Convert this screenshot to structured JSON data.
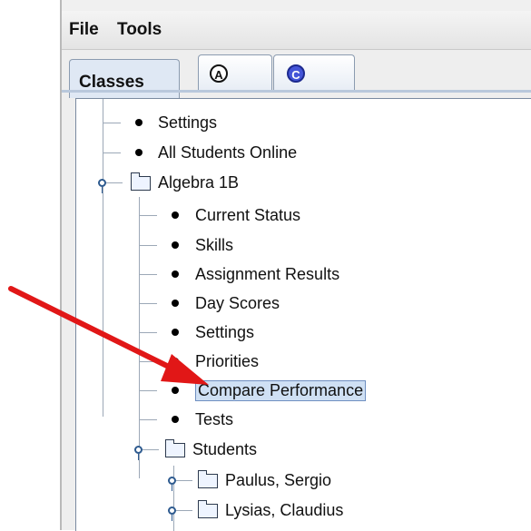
{
  "menu": [
    "File",
    "Tools"
  ],
  "tabs": {
    "classes_label": "Classes",
    "a_glyph": "A",
    "c_glyph": "C"
  },
  "tree": [
    {
      "label": "Settings",
      "level": 0,
      "kind": "bullet"
    },
    {
      "label": "All Students Online",
      "level": 0,
      "kind": "bullet"
    },
    {
      "label": "Algebra 1B",
      "level": 0,
      "kind": "folder",
      "expanded": true
    },
    {
      "label": "Current Status",
      "level": 1,
      "kind": "bullet"
    },
    {
      "label": "Skills",
      "level": 1,
      "kind": "bullet"
    },
    {
      "label": "Assignment Results",
      "level": 1,
      "kind": "bullet"
    },
    {
      "label": "Day Scores",
      "level": 1,
      "kind": "bullet"
    },
    {
      "label": "Settings",
      "level": 1,
      "kind": "bullet"
    },
    {
      "label": "Priorities",
      "level": 1,
      "kind": "bullet"
    },
    {
      "label": "Compare Performance",
      "level": 1,
      "kind": "bullet",
      "selected": true
    },
    {
      "label": "Tests",
      "level": 1,
      "kind": "bullet"
    },
    {
      "label": "Students",
      "level": 1,
      "kind": "folder",
      "expanded": true
    },
    {
      "label": "Paulus, Sergio",
      "level": 2,
      "kind": "folder"
    },
    {
      "label": "Lysias, Claudius",
      "level": 2,
      "kind": "folder"
    }
  ],
  "colors": {
    "selection_fill": "#cfe0f4",
    "selection_border": "#6f8fc1",
    "arrow": "#e11717"
  }
}
